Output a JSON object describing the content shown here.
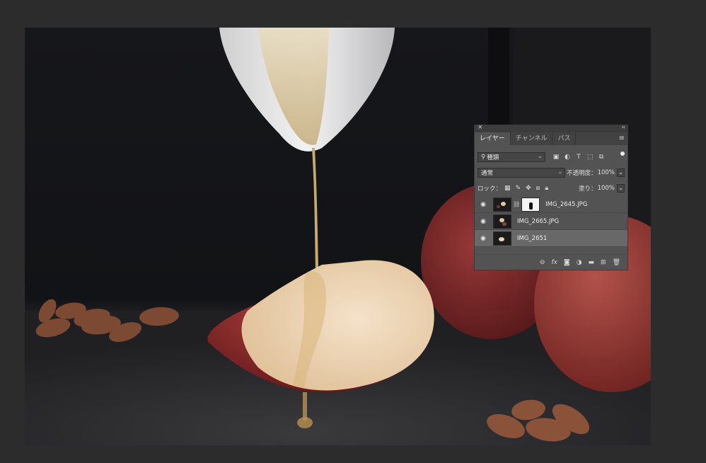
{
  "panel": {
    "close": "×",
    "collapse": "‹‹",
    "tabs": [
      {
        "label": "レイヤー"
      },
      {
        "label": "チャンネル"
      },
      {
        "label": "パス"
      }
    ],
    "filter": {
      "label": "種類"
    },
    "blend_mode": "通常",
    "opacity": {
      "label": "不透明度：",
      "value": "100%"
    },
    "lock": {
      "label": "ロック："
    },
    "fill": {
      "label": "塗り：",
      "value": "100%"
    },
    "layers": [
      {
        "name": "IMG_2645.JPG",
        "has_mask": true,
        "visible": true,
        "selected": false
      },
      {
        "name": "IMG_2665.JPG",
        "has_mask": false,
        "visible": true,
        "selected": false
      },
      {
        "name": "IMG_2651",
        "has_mask": false,
        "visible": true,
        "selected": true
      }
    ]
  },
  "icons": {
    "filter": [
      "image-filter-icon",
      "adjustment-filter-icon",
      "type-filter-icon",
      "shape-filter-icon",
      "smart-object-filter-icon"
    ],
    "lock": [
      "lock-transparent-pixels-icon",
      "lock-image-pixels-icon",
      "lock-position-icon",
      "lock-artboard-icon",
      "lock-all-icon"
    ],
    "bottom": [
      "link-layers-icon",
      "fx-icon",
      "add-mask-icon",
      "adjustment-layer-icon",
      "new-group-icon",
      "new-layer-icon",
      "delete-layer-icon"
    ]
  },
  "colors": {
    "app_background": "#2c2c2c",
    "panel": "#535353",
    "selected_layer": "#686868"
  }
}
